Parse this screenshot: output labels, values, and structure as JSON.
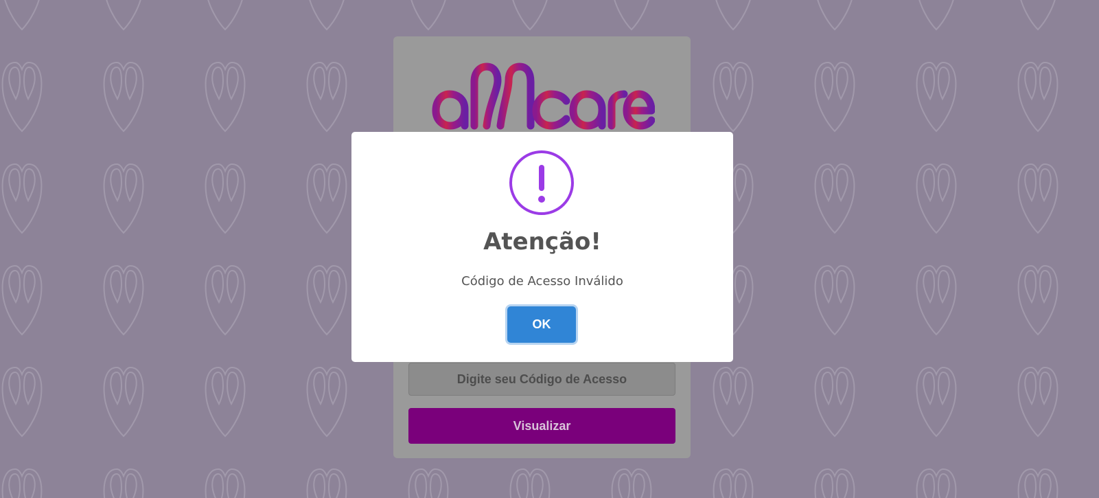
{
  "brand": {
    "logo_text": "allcare",
    "logo_colors": [
      "#c8244f",
      "#8a1a8f",
      "#6a1fa3"
    ]
  },
  "login": {
    "access_code_placeholder": "Digite seu Código de Acesso",
    "view_button_label": "Visualizar"
  },
  "dialog": {
    "icon": "exclamation-circle-icon",
    "icon_color": "#9b3be6",
    "title": "Atenção!",
    "message": "Código de Acesso Inválido",
    "ok_label": "OK",
    "ok_color": "#3085d6"
  },
  "colors": {
    "overlay_background": "#8d8398",
    "button_primary": "#7a007b"
  }
}
